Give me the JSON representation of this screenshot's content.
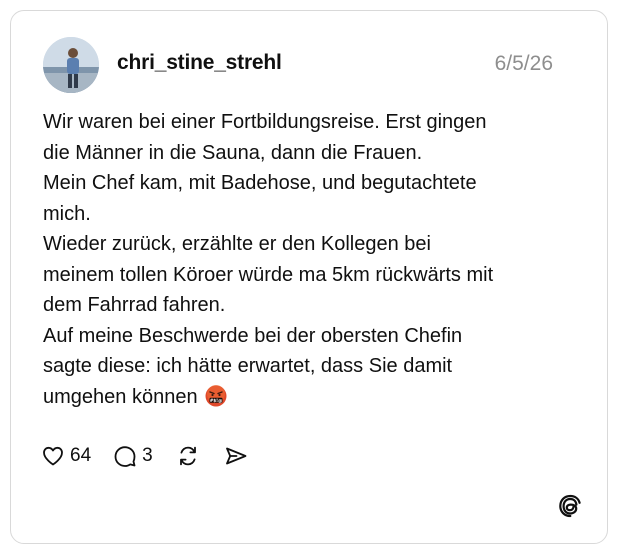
{
  "post": {
    "username": "chri_stine_strehl",
    "date": "6/5/26",
    "lines": [
      "Wir waren bei einer Fortbildungsreise. Erst gingen",
      "die Männer in die Sauna, dann die Frauen.",
      "Mein Chef kam, mit Badehose, und begutachtete",
      "mich.",
      "Wieder zurück, erzählte er den Kollegen bei",
      "meinem tollen Köroer würde ma 5km rückwärts mit",
      "dem Fahrrad fahren.",
      "Auf meine Beschwerde bei der obersten Chefin",
      "sagte diese: ich hätte erwartet, dass Sie damit",
      "umgehen können"
    ],
    "emoji": "face-with-symbols-on-mouth",
    "likes": "64",
    "replies": "3"
  },
  "icons": {
    "like": "heart-icon",
    "reply": "comment-icon",
    "repost": "repost-icon",
    "share": "send-icon",
    "brand": "threads-logo"
  },
  "colors": {
    "text": "#101010",
    "muted": "#8e8e8e",
    "border": "#d9d9d9",
    "emoji_red": "#e0492b"
  }
}
